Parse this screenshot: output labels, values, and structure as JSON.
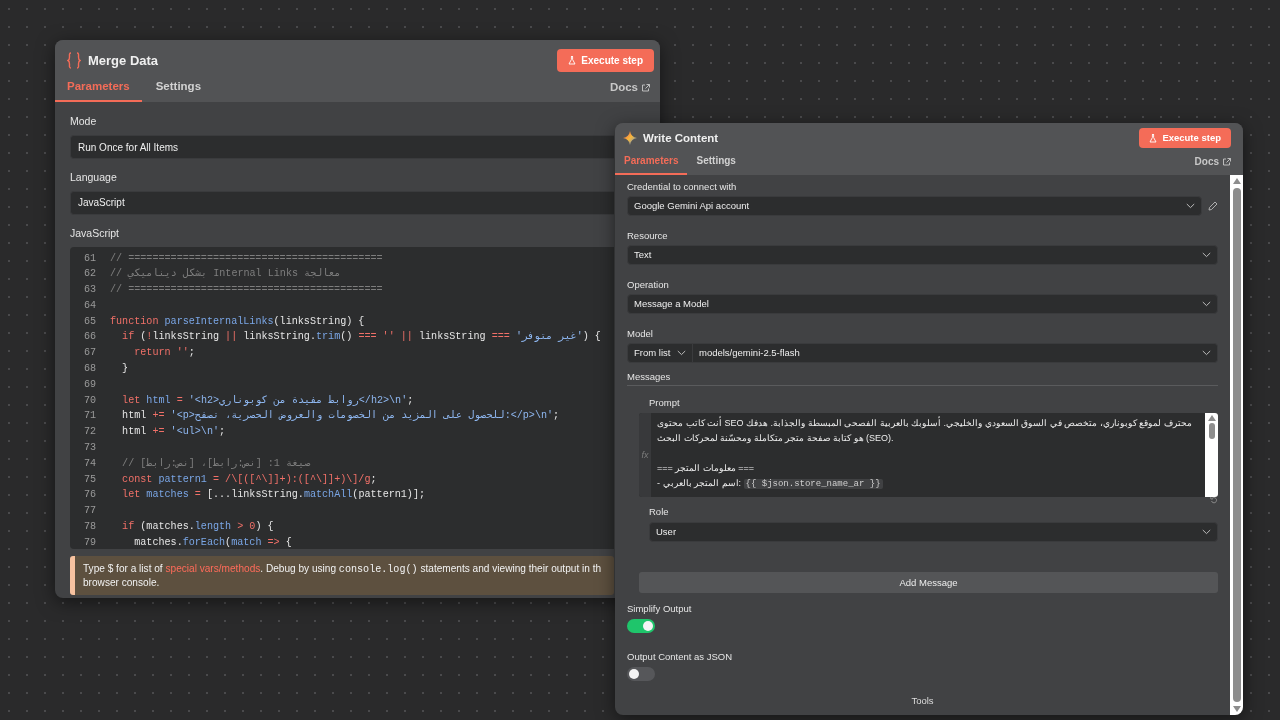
{
  "left_panel": {
    "title": "Merge Data",
    "execute_button": "Execute step",
    "tabs": [
      {
        "label": "Parameters",
        "selected": true
      },
      {
        "label": "Settings",
        "selected": false
      }
    ],
    "docs_link": "Docs",
    "fields": [
      {
        "label": "Mode",
        "value": "Run Once for All Items"
      },
      {
        "label": "Language",
        "value": "JavaScript"
      }
    ],
    "code_label": "JavaScript",
    "code_lines": [
      {
        "number": "61",
        "tokens": [
          {
            "kind": "comment",
            "text": "// =========================================="
          }
        ]
      },
      {
        "number": "62",
        "tokens": [
          {
            "kind": "comment",
            "text": "// بشكل ديناميكي Internal Links معالجة"
          }
        ]
      },
      {
        "number": "63",
        "tokens": [
          {
            "kind": "comment",
            "text": "// =========================================="
          }
        ]
      },
      {
        "number": "64"
      },
      {
        "number": "65",
        "tokens": [
          {
            "kind": "keyword",
            "text": "function"
          },
          {
            "kind": "name",
            "text": " parseInternalLinks"
          },
          {
            "kind": "plain",
            "text": "(linksString) {"
          }
        ]
      },
      {
        "number": "66",
        "tokens": [
          {
            "kind": "keyword",
            "text": "  if"
          },
          {
            "kind": "plain",
            "text": " ("
          },
          {
            "kind": "keyword",
            "text": "!"
          },
          {
            "kind": "plain",
            "text": "linksString "
          },
          {
            "kind": "keyword",
            "text": "||"
          },
          {
            "kind": "plain",
            "text": " linksString."
          },
          {
            "kind": "name",
            "text": "trim"
          },
          {
            "kind": "plain",
            "text": "() "
          },
          {
            "kind": "keyword",
            "text": "=== ''"
          },
          {
            "kind": "keyword",
            "text": " ||"
          },
          {
            "kind": "plain",
            "text": " linksString "
          },
          {
            "kind": "keyword",
            "text": "==="
          },
          {
            "kind": "string",
            "text": " 'غير متوفر'"
          },
          {
            "kind": "plain",
            "text": ") {"
          }
        ]
      },
      {
        "number": "67",
        "tokens": [
          {
            "kind": "keyword",
            "text": "    return ''"
          },
          {
            "kind": "plain",
            "text": ";"
          }
        ]
      },
      {
        "number": "68",
        "tokens": [
          {
            "kind": "plain",
            "text": "  }"
          }
        ]
      },
      {
        "number": "69"
      },
      {
        "number": "70",
        "tokens": [
          {
            "kind": "keyword",
            "text": "  let"
          },
          {
            "kind": "name",
            "text": " html"
          },
          {
            "kind": "keyword",
            "text": " ="
          },
          {
            "kind": "string",
            "text": " '<h2>روابط مفيدة من كوبوناري</h2>\\n'"
          },
          {
            "kind": "plain",
            "text": ";"
          }
        ]
      },
      {
        "number": "71",
        "tokens": [
          {
            "kind": "plain",
            "text": "  html "
          },
          {
            "kind": "keyword",
            "text": "+="
          },
          {
            "kind": "string",
            "text": " '<p>للحصول على المزيد من الخصومات والعروض الحصرية، تصفح:</p>\\n'"
          },
          {
            "kind": "plain",
            "text": ";"
          }
        ]
      },
      {
        "number": "72",
        "tokens": [
          {
            "kind": "plain",
            "text": "  html "
          },
          {
            "kind": "keyword",
            "text": "+="
          },
          {
            "kind": "string",
            "text": " '<ul>\\n'"
          },
          {
            "kind": "plain",
            "text": ";"
          }
        ]
      },
      {
        "number": "73"
      },
      {
        "number": "74",
        "tokens": [
          {
            "kind": "comment",
            "text": "  // صيغة 1: [نص:رابط]، [نص:رابط]"
          }
        ]
      },
      {
        "number": "75",
        "tokens": [
          {
            "kind": "keyword",
            "text": "  const"
          },
          {
            "kind": "name",
            "text": " pattern1"
          },
          {
            "kind": "keyword",
            "text": " ="
          },
          {
            "kind": "keyword",
            "text": " /\\[([^\\]]+):([^\\]]+)\\]/g"
          },
          {
            "kind": "plain",
            "text": ";"
          }
        ]
      },
      {
        "number": "76",
        "tokens": [
          {
            "kind": "keyword",
            "text": "  let"
          },
          {
            "kind": "name",
            "text": " matches"
          },
          {
            "kind": "keyword",
            "text": " ="
          },
          {
            "kind": "plain",
            "text": " [...linksString."
          },
          {
            "kind": "name",
            "text": "matchAll"
          },
          {
            "kind": "plain",
            "text": "(pattern1)];"
          }
        ]
      },
      {
        "number": "77"
      },
      {
        "number": "78",
        "tokens": [
          {
            "kind": "keyword",
            "text": "  if"
          },
          {
            "kind": "plain",
            "text": " (matches."
          },
          {
            "kind": "name",
            "text": "length"
          },
          {
            "kind": "keyword",
            "text": " > 0"
          },
          {
            "kind": "plain",
            "text": ") {"
          }
        ]
      },
      {
        "number": "79",
        "tokens": [
          {
            "kind": "plain",
            "text": "    matches."
          },
          {
            "kind": "name",
            "text": "forEach"
          },
          {
            "kind": "plain",
            "text": "("
          },
          {
            "kind": "name",
            "text": "match"
          },
          {
            "kind": "keyword",
            "text": " =>"
          },
          {
            "kind": "plain",
            "text": " {"
          }
        ]
      }
    ],
    "hint": {
      "lines": [
        [
          {
            "kind": "text",
            "text": "Type $ for a list of "
          },
          {
            "kind": "link",
            "text": "special vars/methods"
          },
          {
            "kind": "text",
            "text": ". Debug by using "
          },
          {
            "kind": "code",
            "text": "console.log()"
          },
          {
            "kind": "text",
            "text": " statements and viewing their output in th"
          }
        ],
        [
          {
            "kind": "text",
            "text": "browser console."
          }
        ]
      ]
    }
  },
  "right_panel": {
    "title": "Write Content",
    "execute_button": "Execute step",
    "tabs": [
      {
        "label": "Parameters",
        "selected": true
      },
      {
        "label": "Settings",
        "selected": false
      }
    ],
    "docs_link": "Docs",
    "fields": [
      {
        "kind": "select",
        "label": "Credential to connect with",
        "value": "Google Gemini Api account",
        "edit_icon": true
      },
      {
        "kind": "select",
        "label": "Resource",
        "value": "Text"
      },
      {
        "kind": "select",
        "label": "Operation",
        "value": "Message a Model"
      },
      {
        "kind": "split",
        "label": "Model",
        "mode": "From list",
        "value": "models/gemini-2.5-flash"
      }
    ],
    "messages": {
      "label": "Messages",
      "prompt": {
        "label": "Prompt",
        "gutter": "fx",
        "paragraphs": [
          [
            {
              "parts": [
                {
                  "kind": "text",
                  "text": "أنت كاتب محتوى SEO محترف لموقع كوبوناري، متخصص في السوق السعودي والخليجي. أسلوبك بالعربية الفصحى المبسطة والجذابة. هدفك هو كتابة صفحة متجر متكاملة ومحسّنة لمحركات البحث (SEO)."
                }
              ]
            }
          ],
          [
            {
              "parts": [
                {
                  "kind": "text",
                  "text": "=== معلومات المتجر ==="
                }
              ]
            },
            {
              "parts": [
                {
                  "kind": "text",
                  "text": "- اسم المتجر بالعربي: "
                },
                {
                  "kind": "expr",
                  "text": "{{ $json.store_name_ar }}"
                }
              ]
            }
          ]
        ]
      },
      "role": {
        "label": "Role",
        "value": "User"
      },
      "add_button": "Add Message"
    },
    "toggles": [
      {
        "label": "Simplify Output",
        "on": true
      },
      {
        "label": "Output Content as JSON",
        "on": false
      }
    ],
    "footer_label": "Tools"
  }
}
